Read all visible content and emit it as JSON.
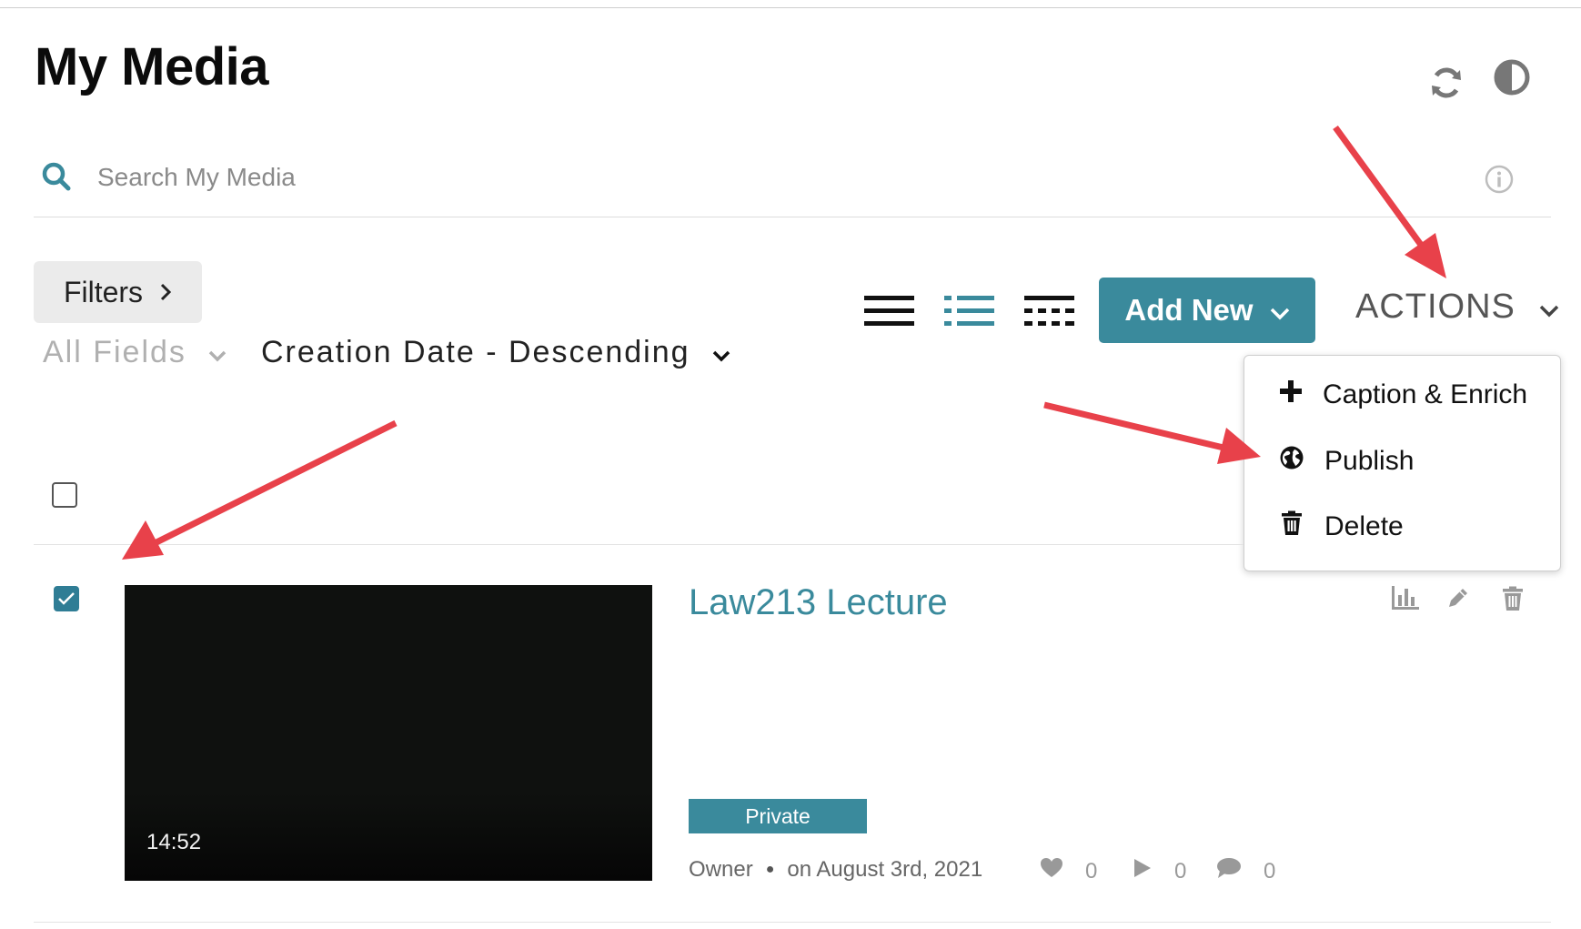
{
  "page": {
    "title": "My Media"
  },
  "search": {
    "placeholder": "Search My Media"
  },
  "filters": {
    "label": "Filters",
    "field_select": "All Fields",
    "sort_select": "Creation Date - Descending"
  },
  "toolbar": {
    "add_new_label": "Add New",
    "actions_label": "ACTIONS"
  },
  "actions_menu": {
    "items": [
      {
        "label": "Caption & Enrich",
        "icon": "plus-icon"
      },
      {
        "label": "Publish",
        "icon": "globe-icon"
      },
      {
        "label": "Delete",
        "icon": "trash-icon"
      }
    ]
  },
  "media": {
    "items": [
      {
        "title": "Law213 Lecture",
        "duration": "14:52",
        "status": "Private",
        "owner": "Owner",
        "date": "on August 3rd, 2021",
        "likes": "0",
        "plays": "0",
        "comments": "0",
        "selected": true
      }
    ]
  },
  "colors": {
    "accent": "#3a8a9c",
    "arrow": "#e8414a"
  }
}
